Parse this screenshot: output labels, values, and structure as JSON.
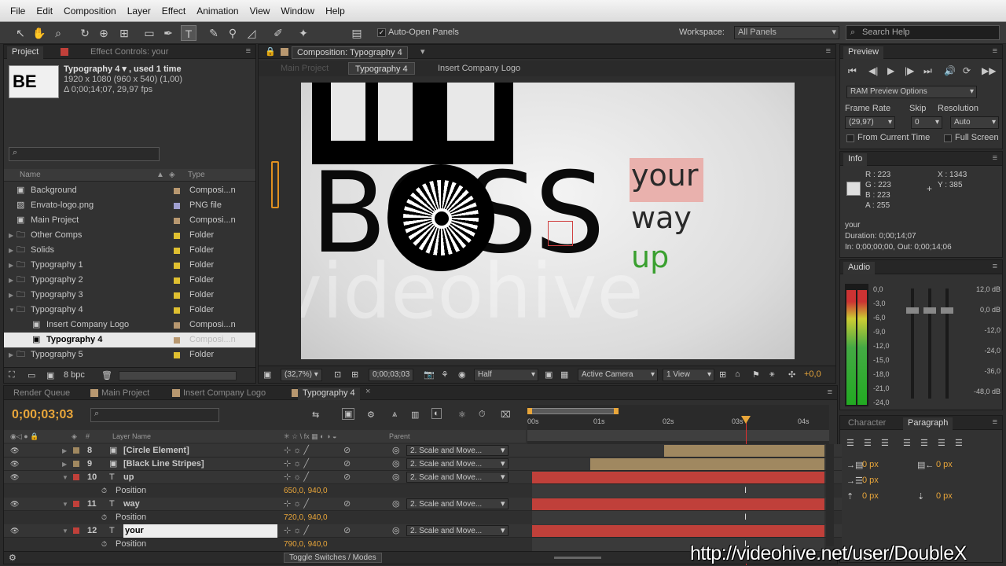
{
  "menu": [
    "File",
    "Edit",
    "Composition",
    "Layer",
    "Effect",
    "Animation",
    "View",
    "Window",
    "Help"
  ],
  "toolbar": {
    "auto_open_label": "Auto-Open Panels",
    "workspace_label": "Workspace:",
    "workspace_value": "All Panels",
    "search_placeholder": "Search Help"
  },
  "project": {
    "tab_project": "Project",
    "tab_effect_controls": "Effect Controls: your",
    "comp_name": "Typography 4 ▾ , used 1 time",
    "comp_res": "1920 x 1080  (960 x 540) (1,00)",
    "comp_dur": "Δ 0;00;14;07, 29,97 fps",
    "thumb_text": "BE",
    "col_name": "Name",
    "col_type": "Type",
    "items": [
      {
        "name": "Background",
        "type": "Composi...n",
        "color": "#b89870",
        "indent": 0,
        "kind": "comp"
      },
      {
        "name": "Envato-logo.png",
        "type": "PNG file",
        "color": "#a0a0d0",
        "indent": 0,
        "kind": "file"
      },
      {
        "name": "Main Project",
        "type": "Composi...n",
        "color": "#b89870",
        "indent": 0,
        "kind": "comp"
      },
      {
        "name": "Other Comps",
        "type": "Folder",
        "color": "#e0c030",
        "indent": 0,
        "kind": "folder"
      },
      {
        "name": "Solids",
        "type": "Folder",
        "color": "#e0c030",
        "indent": 0,
        "kind": "folder"
      },
      {
        "name": "Typography 1",
        "type": "Folder",
        "color": "#e0c030",
        "indent": 0,
        "kind": "folder"
      },
      {
        "name": "Typography 2",
        "type": "Folder",
        "color": "#e0c030",
        "indent": 0,
        "kind": "folder"
      },
      {
        "name": "Typography 3",
        "type": "Folder",
        "color": "#e0c030",
        "indent": 0,
        "kind": "folder"
      },
      {
        "name": "Typography 4",
        "type": "Folder",
        "color": "#e0c030",
        "indent": 0,
        "kind": "folder-open"
      },
      {
        "name": "Insert Company Logo",
        "type": "Composi...n",
        "color": "#b89870",
        "indent": 1,
        "kind": "comp"
      },
      {
        "name": "Typography 4",
        "type": "Composi...n",
        "color": "#b89870",
        "indent": 1,
        "kind": "comp"
      },
      {
        "name": "Typography 5",
        "type": "Folder",
        "color": "#e0c030",
        "indent": 0,
        "kind": "folder"
      }
    ],
    "bpc": "8 bpc"
  },
  "composition": {
    "tab": "Composition: Typography 4",
    "crumbs": [
      "Main Project",
      "Typography 4",
      "Insert Company Logo"
    ],
    "zoom": "(32,7%)",
    "timecode": "0;00;03;03",
    "resolution": "Half",
    "camera": "Active Camera",
    "views": "1 View",
    "offset": "+0,0",
    "words": {
      "boss": "BOSS",
      "your": "your",
      "way": "way",
      "up": "up"
    },
    "watermark": "videohive"
  },
  "preview": {
    "tab": "Preview",
    "ram_options": "RAM Preview Options",
    "frame_rate_label": "Frame Rate",
    "skip_label": "Skip",
    "resolution_label": "Resolution",
    "frame_rate": "(29,97)",
    "skip": "0",
    "resolution": "Auto",
    "from_current": "From Current Time",
    "full_screen": "Full Screen"
  },
  "info": {
    "tab": "Info",
    "r": "R : 223",
    "g": "G : 223",
    "b": "B : 223",
    "a": "A : 255",
    "x": "X : 1343",
    "y": "Y : 385",
    "layer": "your",
    "duration": "Duration: 0;00;14;07",
    "inout": "In: 0;00;00;00, Out: 0;00;14;06",
    "swatch": "#dfdfdf"
  },
  "audio": {
    "tab": "Audio",
    "left_scale": [
      "0,0",
      "-3,0",
      "-6,0",
      "-9,0",
      "-12,0",
      "-15,0",
      "-18,0",
      "-21,0",
      "-24,0"
    ],
    "right_scale": [
      "12,0 dB",
      "0,0 dB",
      "-12,0",
      "-24,0",
      "-36,0",
      "-48,0 dB"
    ]
  },
  "character": {
    "tab_character": "Character",
    "tab_paragraph": "Paragraph",
    "px": [
      "0 px",
      "0 px",
      "0 px",
      "0 px",
      "0 px"
    ]
  },
  "timeline": {
    "tabs": [
      "Render Queue",
      "Main Project",
      "Insert Company Logo",
      "Typography 4"
    ],
    "timecode": "0;00;03;03",
    "col_layer": "Layer Name",
    "col_parent": "Parent",
    "ruler": [
      "00s",
      "01s",
      "02s",
      "03s",
      "04s"
    ],
    "layers": [
      {
        "num": "8",
        "name": "[Circle Element]",
        "parent": "2. Scale and Move...",
        "color": "#a08860"
      },
      {
        "num": "9",
        "name": "[Black Line Stripes]",
        "parent": "2. Scale and Move...",
        "color": "#a08860"
      },
      {
        "num": "10",
        "name": "up",
        "parent": "2. Scale and Move...",
        "color": "#c0403a"
      },
      {
        "num": "11",
        "name": "way",
        "parent": "2. Scale and Move...",
        "color": "#c0403a"
      },
      {
        "num": "12",
        "name": "your",
        "parent": "2. Scale and Move...",
        "color": "#c0403a"
      }
    ],
    "pos_label": "Position",
    "positions": [
      "650,0, 940,0",
      "720,0, 940,0",
      "790,0, 940,0"
    ],
    "toggle": "Toggle Switches / Modes"
  },
  "url": "http://videohive.net/user/DoubleX"
}
